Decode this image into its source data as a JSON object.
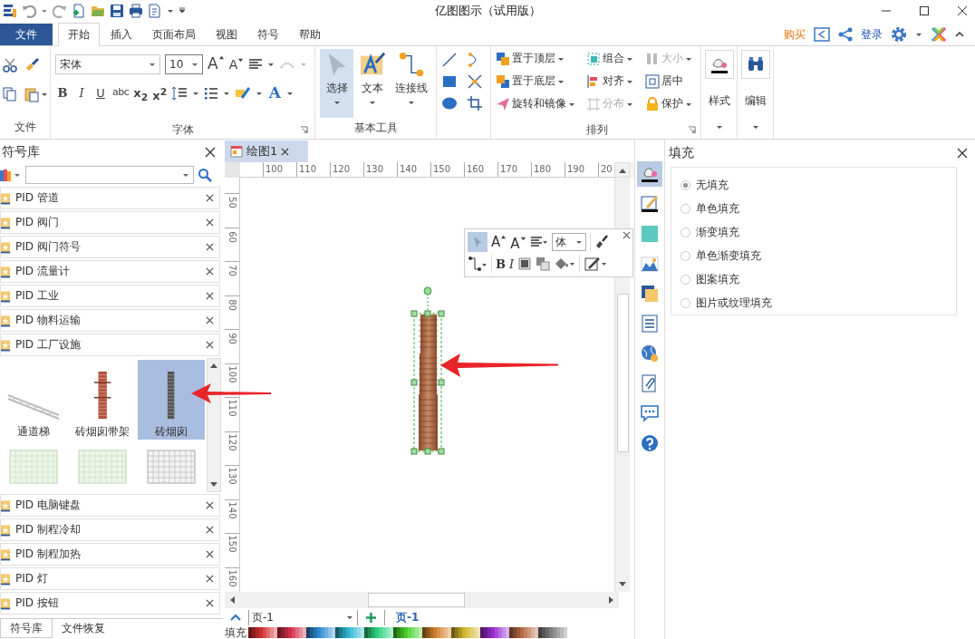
{
  "window": {
    "title": "亿图图示（试用版）"
  },
  "ribbon_tabs": [
    {
      "label": "文件",
      "kind": "file",
      "selected": false
    },
    {
      "label": "开始",
      "kind": "tab",
      "selected": true
    },
    {
      "label": "插入",
      "kind": "tab",
      "selected": false
    },
    {
      "label": "页面布局",
      "kind": "tab",
      "selected": false
    },
    {
      "label": "视图",
      "kind": "tab",
      "selected": false
    },
    {
      "label": "符号",
      "kind": "tab",
      "selected": false
    },
    {
      "label": "帮助",
      "kind": "tab",
      "selected": false
    }
  ],
  "account": {
    "buy": "购买",
    "login": "登录"
  },
  "clipboard_group": {
    "label": "文件"
  },
  "font_group": {
    "label": "字体",
    "font": "宋体",
    "size": "10",
    "grow": "A",
    "shrink": "A",
    "color_button": "A",
    "format": [
      {
        "kind": "bold",
        "label": "B"
      },
      {
        "kind": "italic",
        "label": "I"
      },
      {
        "kind": "underline",
        "label": "U"
      },
      {
        "kind": "strike",
        "label": "abc"
      },
      {
        "kind": "sub",
        "label": "x$_{2}$"
      },
      {
        "kind": "sup",
        "label": "x$^{2}$"
      }
    ]
  },
  "tools_group": {
    "label": "基本工具",
    "tools": [
      {
        "label": "选择",
        "kind": "select",
        "selected": true
      },
      {
        "label": "文本",
        "kind": "text",
        "selected": false
      },
      {
        "label": "连接线",
        "kind": "connector",
        "selected": false
      }
    ]
  },
  "arrange_group": {
    "label": "排列",
    "items": [
      {
        "label": "置于顶层",
        "kind": "front",
        "disabled": false
      },
      {
        "label": "组合",
        "kind": "group",
        "disabled": false
      },
      {
        "label": "大小",
        "kind": "size",
        "disabled": true
      },
      {
        "label": "置于底层",
        "kind": "back",
        "disabled": false
      },
      {
        "label": "对齐",
        "kind": "align",
        "disabled": false
      },
      {
        "label": "居中",
        "kind": "center",
        "disabled": false
      },
      {
        "label": "旋转和镜像",
        "kind": "rotate",
        "disabled": false
      },
      {
        "label": "分布",
        "kind": "distribute",
        "disabled": true
      },
      {
        "label": "保护",
        "kind": "protect",
        "disabled": false
      }
    ]
  },
  "style_button": {
    "label": "样式"
  },
  "edit_button": {
    "label": "编辑"
  },
  "library": {
    "title": "符号库",
    "categories_above": [
      "PID 管道",
      "PID 阀门",
      "PID 阀门符号",
      "PID 流量计",
      "PID 工业",
      "PID 物料运输",
      "PID 工厂设施"
    ],
    "shapes": [
      {
        "label": "通道梯",
        "kind": "ladder",
        "selected": false
      },
      {
        "label": "砖烟囱带架",
        "kind": "chimney-frame",
        "selected": false
      },
      {
        "label": "砖烟囱",
        "kind": "chimney",
        "selected": true
      },
      {
        "kind": "fence-green",
        "selected": false
      },
      {
        "kind": "fence-light",
        "selected": false
      },
      {
        "kind": "fence-grey",
        "selected": false
      }
    ],
    "categories_below": [
      "PID 电脑键盘",
      "PID 制程冷却",
      "PID 制程加热",
      "PID 灯",
      "PID 按钮"
    ],
    "tabs": [
      {
        "label": "符号库",
        "selected": true
      },
      {
        "label": "文件恢复",
        "selected": false
      }
    ]
  },
  "document": {
    "tab": "绘图1",
    "x_ruler": [
      "100",
      "110",
      "120",
      "130",
      "140",
      "150",
      "160",
      "170",
      "180",
      "190",
      "20"
    ],
    "y_ruler": [
      "50",
      "60",
      "70",
      "80",
      "90",
      "100",
      "110",
      "120",
      "130",
      "140",
      "150",
      "160"
    ]
  },
  "mini_toolbar": {
    "grow": "A",
    "shrink": "A",
    "font": "体",
    "bold": "B",
    "italic": "I"
  },
  "page_bar": {
    "page_select": "页-1",
    "page_tab": "页-1"
  },
  "palette": {
    "label": "填充"
  },
  "side_tools": [
    {
      "kind": "fill",
      "selected": true
    },
    {
      "kind": "line",
      "selected": false
    },
    {
      "kind": "shadow",
      "selected": false
    },
    {
      "kind": "image",
      "selected": false
    },
    {
      "kind": "page",
      "selected": false
    },
    {
      "kind": "list",
      "selected": false
    },
    {
      "kind": "globe",
      "selected": false
    },
    {
      "kind": "attachment",
      "selected": false
    },
    {
      "kind": "comment",
      "selected": false
    },
    {
      "kind": "help",
      "selected": false
    }
  ],
  "fill_panel": {
    "title": "填充",
    "options": [
      {
        "label": "无填充",
        "selected": true
      },
      {
        "label": "单色填充",
        "selected": false
      },
      {
        "label": "渐变填充",
        "selected": false
      },
      {
        "label": "单色渐变填充",
        "selected": false
      },
      {
        "label": "图案填充",
        "selected": false
      },
      {
        "label": "图片或纹理填充",
        "selected": false
      }
    ]
  }
}
